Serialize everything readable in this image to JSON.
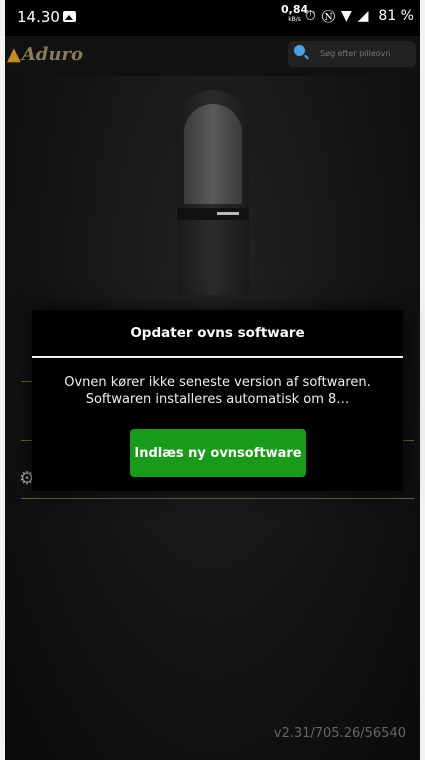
{
  "status_bar": {
    "time": "14.30",
    "net_speed_value": "0,84",
    "net_speed_unit": "kB/s",
    "battery": "81 %"
  },
  "app_bar": {
    "logo_text": "Aduro",
    "search_placeholder": "Søg efter pilleovn"
  },
  "dialog": {
    "title": "Opdater ovns software",
    "message": "Ovnen kører ikke seneste version af softwaren. Softwaren installeres automatisk om 8…",
    "button_label": "Indlæs ny ovnsoftware"
  },
  "footer": {
    "version": "v2.31/705.26/56540"
  },
  "colors": {
    "accent_green": "#1a9a1a",
    "logo_brown": "#8a7a5a"
  }
}
